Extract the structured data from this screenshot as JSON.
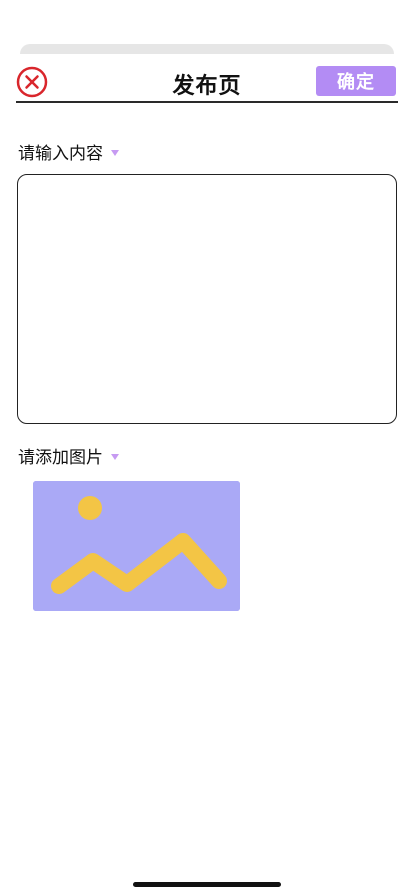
{
  "header": {
    "title": "发布页",
    "confirm_label": "确定",
    "close_icon": "close-circle-icon",
    "accent_color": "#b38cf4",
    "close_color": "#d9262c"
  },
  "content_section": {
    "label": "请输入内容",
    "input_value": "",
    "input_placeholder": ""
  },
  "image_section": {
    "label": "请添加图片",
    "placeholder_icon": "image-placeholder-icon",
    "colors": {
      "background": "#aaa9f6",
      "sun": "#f3c545",
      "wave": "#f3c545"
    }
  },
  "colors": {
    "caret": "#c69af2",
    "divider": "#2a2a2a",
    "top_strip": "#e6e6e6"
  }
}
